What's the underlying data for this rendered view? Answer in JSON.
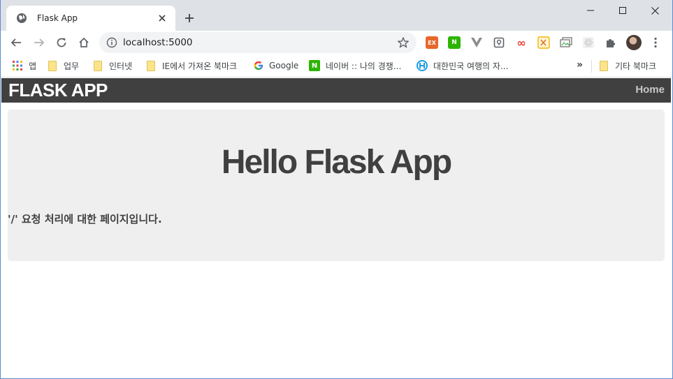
{
  "window": {
    "controls": [
      "minimize",
      "maximize",
      "close"
    ]
  },
  "tab": {
    "title": "Flask App",
    "favicon": "globe-icon"
  },
  "toolbar": {
    "url": "localhost:5000",
    "extensions": [
      {
        "name": "ex-extension-icon",
        "label": "EX",
        "color": "#e8672a"
      },
      {
        "name": "naver-extension-icon",
        "label": "N",
        "color": "#2db400"
      },
      {
        "name": "vue-devtools-icon",
        "label": "",
        "color": "#8b8b8b"
      },
      {
        "name": "keep-extension-icon",
        "label": "",
        "color": "#5f6368"
      },
      {
        "name": "infinity-extension-icon",
        "label": "∞",
        "color": "#e94235"
      },
      {
        "name": "translate-extension-icon",
        "label": "",
        "color": "#f4b400"
      },
      {
        "name": "window-extension-icon",
        "label": "",
        "color": "#757575"
      },
      {
        "name": "react-extension-icon",
        "label": "",
        "color": "#cfcfcf"
      },
      {
        "name": "puzzle-icon",
        "label": "",
        "color": "#5f6368"
      }
    ]
  },
  "bookmarks": {
    "items": [
      {
        "label": "앱",
        "icon": "apps-grid-icon"
      },
      {
        "label": "업무",
        "icon": "folder-icon"
      },
      {
        "label": "인터넷",
        "icon": "folder-icon"
      },
      {
        "label": "IE에서 가져온 북마크",
        "icon": "folder-icon"
      },
      {
        "label": "Google",
        "icon": "google-icon"
      },
      {
        "label": "네이버 :: 나의 경쟁...",
        "icon": "naver-icon"
      },
      {
        "label": "대한민국 여행의 자...",
        "icon": "travel-icon"
      }
    ],
    "overflow": "»",
    "other": "기타 북마크"
  },
  "page": {
    "brand": "FLASK APP",
    "nav_home": "Home",
    "heading": "Hello Flask App",
    "text": "'/' 요청 처리에 대한 페이지입니다."
  },
  "colors": {
    "navbar": "#404040",
    "jumbotron": "#efefef",
    "text": "#404040"
  }
}
